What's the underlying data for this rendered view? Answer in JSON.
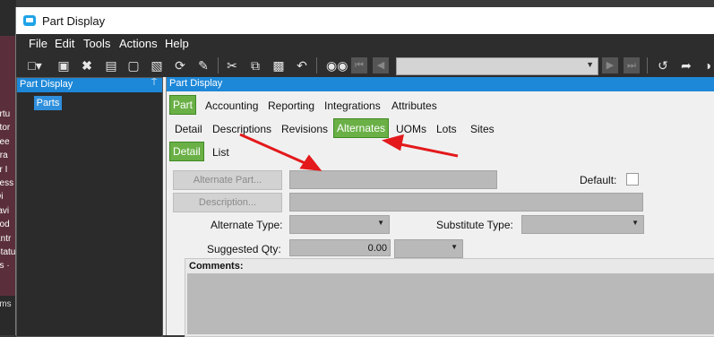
{
  "window": {
    "title": "Part Display"
  },
  "menu": [
    "File",
    "Edit",
    "Tools",
    "Actions",
    "Help"
  ],
  "toolbar_icons": [
    "new-icon",
    "save-icon",
    "delete-icon",
    "open-book-icon",
    "note-icon",
    "clipboard-icon",
    "refresh-icon",
    "clear-icon",
    "cut-icon",
    "copy-icon",
    "paste-icon",
    "undo-icon",
    "binoculars-icon",
    "first-icon",
    "prev-icon",
    "next-icon",
    "last-icon",
    "back-icon",
    "forward-icon",
    "globe-icon"
  ],
  "tree": {
    "header": "Part Display",
    "pin": "⍑",
    "item": "Parts"
  },
  "main": {
    "header": "Part Display",
    "tabs_top": [
      "Part",
      "Accounting",
      "Reporting",
      "Integrations",
      "Attributes"
    ],
    "tabs_mid": [
      "Detail",
      "Descriptions",
      "Revisions",
      "Alternates",
      "UOMs",
      "Lots",
      "Sites"
    ],
    "tabs_bottom": [
      "Detail",
      "List"
    ],
    "form": {
      "alternate_part_btn": "Alternate Part...",
      "description_btn": "Description...",
      "default_label": "Default:",
      "alternate_type_label": "Alternate Type:",
      "substitute_type_label": "Substitute Type:",
      "suggested_qty_label": "Suggested Qty:",
      "suggested_qty_value": "0.00",
      "comments_label": "Comments:"
    }
  },
  "desktop": {
    "lines": [
      "ortu",
      "ator",
      "hee",
      "Tra",
      "or I",
      "ness",
      "Di",
      "ravi",
      "ood",
      "Entr",
      "Statu",
      "as ·"
    ],
    "bottom": "rms"
  },
  "colors": {
    "accent_blue": "#1e88d8",
    "tab_green": "#6ab046",
    "arrow_red": "#e3191b"
  }
}
